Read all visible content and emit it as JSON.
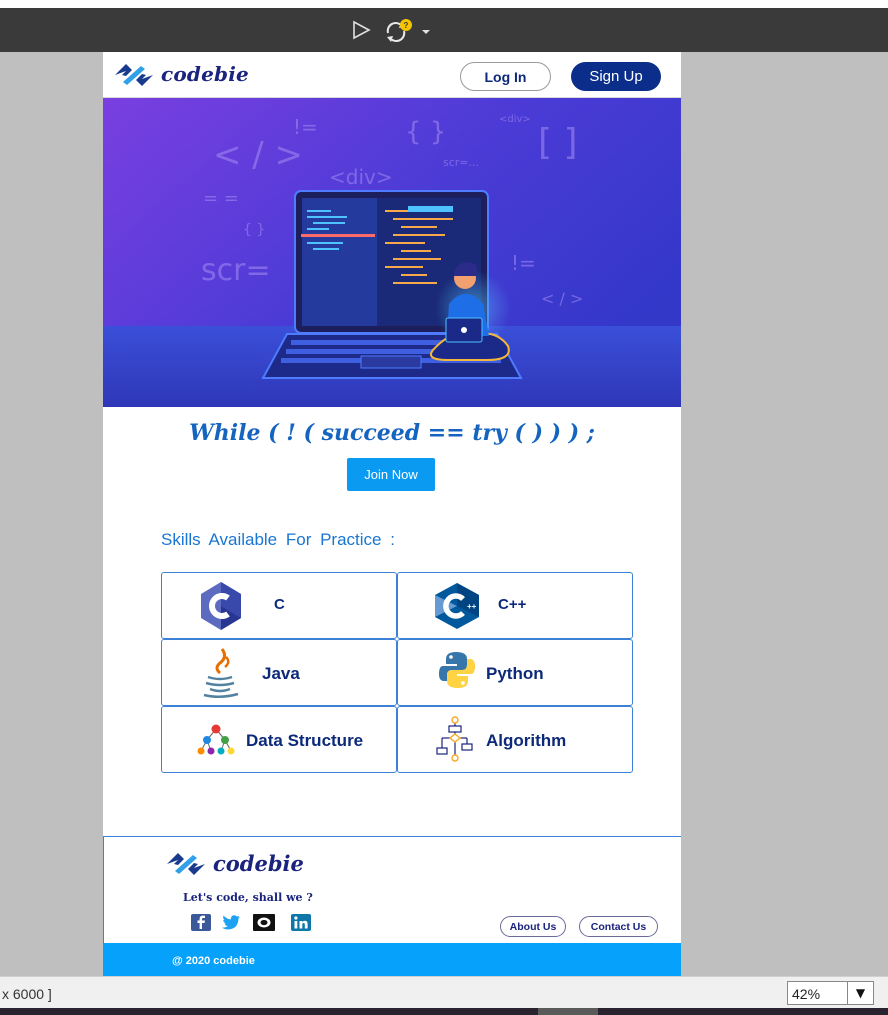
{
  "brand": {
    "name": "codebie"
  },
  "header": {
    "login_label": "Log In",
    "signup_label": "Sign Up"
  },
  "hero": {
    "code_glyphs": [
      "< / >",
      "!=",
      "{ }",
      "<div>",
      "[ ]",
      "scr=...",
      "= =",
      "{ }",
      "scr=",
      "< / >",
      "<div>",
      "!="
    ]
  },
  "tagline": "While ( ! ( succeed == try ( ) ) ) ;",
  "join_label": "Join Now",
  "skills_title": "Skills Available For Practice :",
  "skills": [
    {
      "label": "C",
      "icon": "c-language-icon"
    },
    {
      "label": "C++",
      "icon": "cpp-language-icon"
    },
    {
      "label": "Java",
      "icon": "java-icon"
    },
    {
      "label": "Python",
      "icon": "python-icon"
    },
    {
      "label": "Data Structure",
      "icon": "data-structure-icon"
    },
    {
      "label": "Algorithm",
      "icon": "algorithm-flowchart-icon"
    }
  ],
  "footer": {
    "slogan": "Let's code, shall we ?",
    "about_label": "About Us",
    "contact_label": "Contact Us",
    "copyright": "@ 2020 codebie"
  },
  "statusbar": {
    "dims_text": "x 6000 ]",
    "zoom": "42%"
  },
  "colors": {
    "brand_navy": "#0a2e8a",
    "accent_blue": "#05a1fa",
    "hero_purple": "#5b35d6"
  }
}
